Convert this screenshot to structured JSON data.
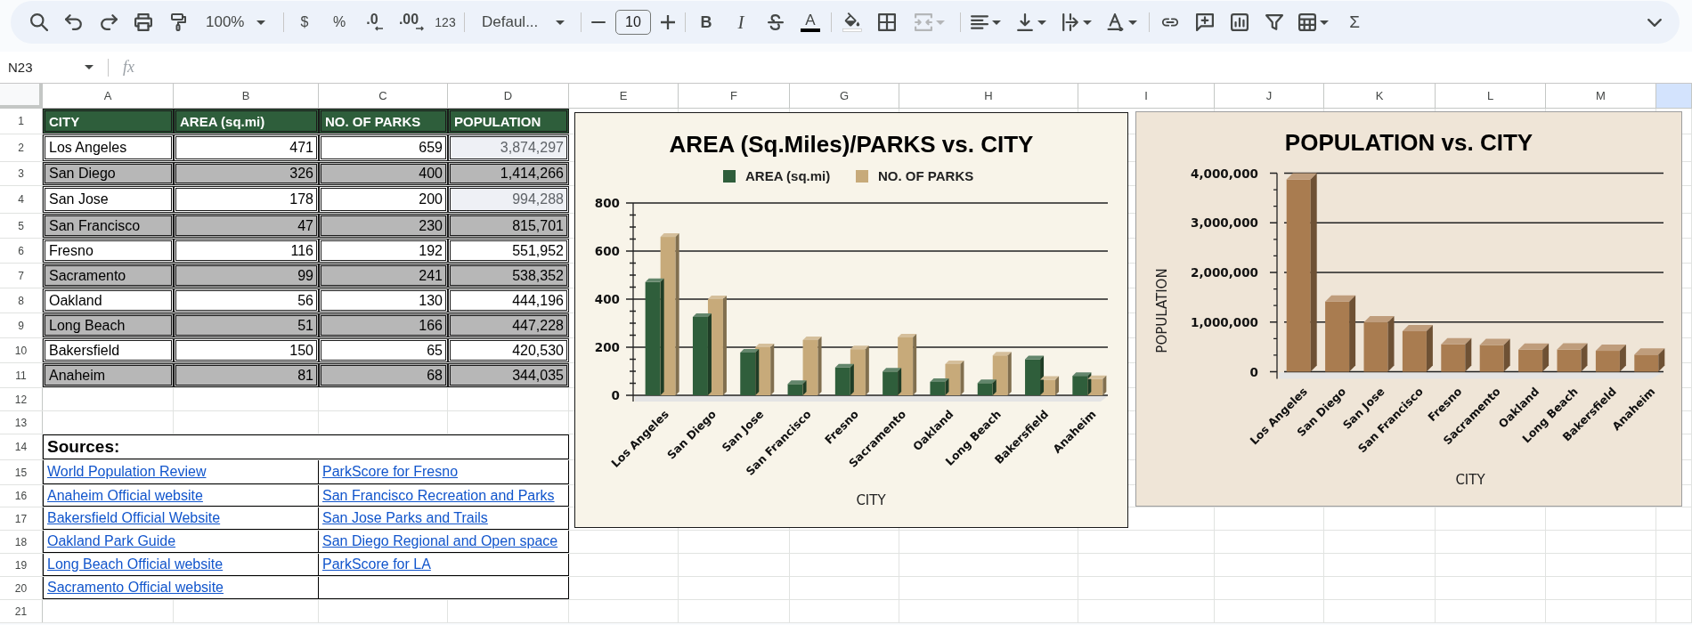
{
  "toolbar": {
    "zoom": "100%",
    "number_formats": [
      "$",
      "%",
      ".0",
      ".00",
      "123"
    ],
    "font": "Defaul...",
    "font_size": "10",
    "bold": "B",
    "italic": "I",
    "text_color": "A",
    "merge": {
      "disabled": true
    },
    "functions": "Σ"
  },
  "formula_bar": {
    "name_box": "N23",
    "fx": "fx"
  },
  "column_headers": [
    {
      "label": "A",
      "selected": false
    },
    {
      "label": "B",
      "selected": false
    },
    {
      "label": "C",
      "selected": false
    },
    {
      "label": "D",
      "selected": false
    },
    {
      "label": "E",
      "selected": false
    },
    {
      "label": "F",
      "selected": false
    },
    {
      "label": "G",
      "selected": false
    },
    {
      "label": "H",
      "selected": false
    },
    {
      "label": "I",
      "selected": false
    },
    {
      "label": "J",
      "selected": false
    },
    {
      "label": "K",
      "selected": false
    },
    {
      "label": "L",
      "selected": false
    },
    {
      "label": "M",
      "selected": false
    },
    {
      "selected": true
    }
  ],
  "row_headers": [
    "1",
    "2",
    "3",
    "4",
    "5",
    "6",
    "7",
    "8",
    "9",
    "10",
    "11",
    "12",
    "13",
    "14",
    "15",
    "16",
    "17",
    "18",
    "19",
    "20",
    "21"
  ],
  "table": {
    "columns": [
      "CITY",
      "AREA (sq.mi)",
      "NO. OF PARKS",
      "POPULATION"
    ],
    "rows": [
      {
        "cells": [
          "Los Angeles",
          "471",
          "659",
          "3,874,297"
        ],
        "shaded": false,
        "population_tinted": true
      },
      {
        "cells": [
          "San Diego",
          "326",
          "400",
          "1,414,266"
        ],
        "shaded": true,
        "population_tinted": false
      },
      {
        "cells": [
          "San Jose",
          "178",
          "200",
          "994,288"
        ],
        "shaded": false,
        "population_tinted": true
      },
      {
        "cells": [
          "San Francisco",
          "47",
          "230",
          "815,701"
        ],
        "shaded": true,
        "population_tinted": false
      },
      {
        "cells": [
          "Fresno",
          "116",
          "192",
          "551,952"
        ],
        "shaded": false,
        "population_tinted": false
      },
      {
        "cells": [
          "Sacramento",
          "99",
          "241",
          "538,352"
        ],
        "shaded": true,
        "population_tinted": false
      },
      {
        "cells": [
          "Oakland",
          "56",
          "130",
          "444,196"
        ],
        "shaded": false,
        "population_tinted": false
      },
      {
        "cells": [
          "Long Beach",
          "51",
          "166",
          "447,228"
        ],
        "shaded": true,
        "population_tinted": false
      },
      {
        "cells": [
          "Bakersfield",
          "150",
          "65",
          "420,530"
        ],
        "shaded": false,
        "population_tinted": false
      },
      {
        "cells": [
          "Anaheim",
          "81",
          "68",
          "344,035"
        ],
        "shaded": true,
        "population_tinted": false
      }
    ]
  },
  "sources": {
    "title": "Sources:",
    "links": [
      {
        "left": "World Population Review",
        "right": "ParkScore for Fresno"
      },
      {
        "left": "Anaheim Official website",
        "right": "San Francisco Recreation and Parks"
      },
      {
        "left": "Bakersfield Official Website",
        "right": "San Jose Parks and Trails"
      },
      {
        "left": "Oakland Park Guide",
        "right": "San Diego Regional and Open space"
      },
      {
        "left": "Long Beach Official website",
        "right": "ParkScore for LA"
      },
      {
        "left": "Sacramento Official website"
      }
    ]
  },
  "charts": [
    {
      "chart_data": {
        "type": "bar",
        "title": "AREA (Sq.Miles)/PARKS vs. CITY",
        "xlabel": "CITY",
        "categories": [
          "Los Angeles",
          "San Diego",
          "San Jose",
          "San Francisco",
          "Fresno",
          "Sacramento",
          "Oakland",
          "Long Beach",
          "Bakersfield",
          "Anaheim"
        ],
        "series": [
          {
            "name": "AREA (sq.mi)",
            "color": "#2f5e3b",
            "values": [
              471,
              326,
              178,
              47,
              116,
              99,
              56,
              51,
              150,
              81
            ]
          },
          {
            "name": "NO. OF PARKS",
            "color": "#c7aa7a",
            "values": [
              659,
              400,
              200,
              230,
              192,
              241,
              130,
              166,
              65,
              68
            ]
          }
        ],
        "ylim": [
          0,
          800
        ],
        "yticks": [
          0,
          200,
          400,
          600,
          800
        ],
        "grid": true,
        "legend": "top"
      }
    },
    {
      "chart_data": {
        "type": "bar",
        "title": "POPULATION vs. CITY",
        "xlabel": "CITY",
        "ylabel": "POPULATION",
        "categories": [
          "Los Angeles",
          "San Diego",
          "San Jose",
          "San Francisco",
          "Fresno",
          "Sacramento",
          "Oakland",
          "Long Beach",
          "Bakersfield",
          "Anaheim"
        ],
        "series": [
          {
            "color": "#a97c50",
            "values": [
              3874297,
              1414266,
              994288,
              815701,
              551952,
              538352,
              444196,
              447228,
              420530,
              344035
            ]
          }
        ],
        "ylim": [
          0,
          4000000
        ],
        "yticks": [
          {
            "value": 0,
            "label": "0"
          },
          {
            "value": 1000000,
            "label": "1,000,000"
          },
          {
            "value": 2000000,
            "label": "2,000,000"
          },
          {
            "value": 3000000,
            "label": "3,000,000"
          },
          {
            "value": 4000000,
            "label": "4,000,000"
          }
        ],
        "grid": true
      }
    }
  ]
}
